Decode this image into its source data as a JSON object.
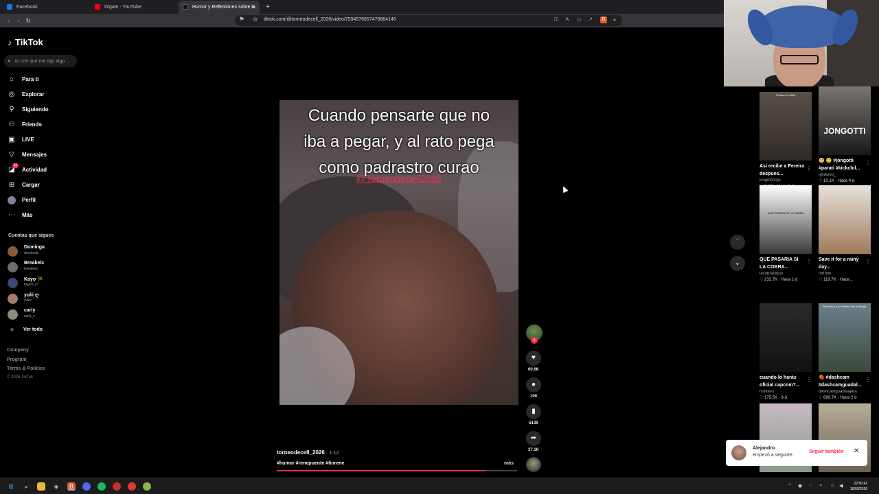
{
  "browser": {
    "tabs": [
      {
        "label": "Facebook",
        "color": "#1877f2"
      },
      {
        "label": "Dígale - YouTube",
        "color": "#ff0000"
      },
      {
        "label": "Humor y Reflexiones sobre la",
        "color": "#111111"
      }
    ],
    "url": "tiktok.com/@torneodecell_2026/video/7594576657478864146"
  },
  "sidebar": {
    "logo": "TikTok",
    "search_placeholder": "tu crei que me dijo algo ...",
    "nav": [
      {
        "label": "Para ti",
        "icon": "home-icon"
      },
      {
        "label": "Explorar",
        "icon": "compass-icon"
      },
      {
        "label": "Siguiendo",
        "icon": "user-follow-icon"
      },
      {
        "label": "Friends",
        "icon": "friends-icon"
      },
      {
        "label": "LIVE",
        "icon": "live-icon"
      },
      {
        "label": "Mensajes",
        "icon": "paper-plane-icon"
      },
      {
        "label": "Actividad",
        "icon": "bell-icon",
        "badge": "11"
      },
      {
        "label": "Cargar",
        "icon": "plus-square-icon"
      },
      {
        "label": "Perfil",
        "icon": "profile-avatar-icon"
      },
      {
        "label": "Más",
        "icon": "more-icon"
      }
    ],
    "following_title": "Cuentas que sigues",
    "following": [
      {
        "name": "Dominga",
        "handle": "domincat",
        "color": "#8a5a3c"
      },
      {
        "name": "Breakelx",
        "handle": "ibreakelx",
        "color": "#6d6d6d"
      },
      {
        "name": "Kayo 🎋",
        "handle": "kayoo_cl",
        "color": "#3a4a7a"
      },
      {
        "name": "yulii ღ",
        "handle": "yvlliv",
        "color": "#a47c6c"
      },
      {
        "name": "carly",
        "handle": "carly_v",
        "color": "#8c8c7c"
      }
    ],
    "ver_todo": "Ver todo",
    "footer_links": [
      "Company",
      "Program",
      "Terms & Policies"
    ],
    "copyright": "© 2026 TikTok"
  },
  "video": {
    "caption_lines": [
      "Cuando pensarte que no",
      "iba a pegar, y al rato pega",
      "como padrastro curao"
    ],
    "overlay_tag": "@Torneodecell2026",
    "username": "torneodecell_2026",
    "date": "1-12",
    "hashtags": "#humor #renepuente #tiorene",
    "more_label": "más",
    "progress": 0.87
  },
  "actions": {
    "follow_plus": "+",
    "likes": "60.6K",
    "comments": "109",
    "saves": "5139",
    "shares": "37.1K"
  },
  "recommendations": [
    {
      "title": "Asi recibe a Pereira despues...",
      "author": "kingofsclips",
      "stats": "♡ 5469 · Hace 5 d",
      "thumb_label": "Pereira en Chile",
      "c1": "#5a5048",
      "c2": "#2f2a26"
    },
    {
      "title": "🙂 🙂 #jongotti #parati #kickchil...",
      "author": "igxacioo_",
      "stats": "♡ 10.1K · Hace 4 d",
      "thumb_label": "JONGOTTI",
      "c1": "#7b7570",
      "c2": "#1a1a1a"
    },
    {
      "title": "QUE PASARIA SI LA COBRA...",
      "author": "lacobraclipsx",
      "stats": "♡ 232.7K · Hace 1 d",
      "thumb_label": "QUE PASARIA SI LA COBRA",
      "c1": "#ffffff",
      "c2": "#3a3a3a"
    },
    {
      "title": "Save it for a rainy day...",
      "author": "fortnite",
      "stats": "♡ 118.7K · Hace...",
      "thumb_label": "",
      "c1": "#e8e2dc",
      "c2": "#a07a5a"
    },
    {
      "title": "cuando lo harás oficial capcom?...",
      "author": "huntevs",
      "stats": "♡ 175.5K · 3-3",
      "thumb_label": "",
      "c1": "#2b2b2b",
      "c2": "#111111"
    },
    {
      "title": "🍓 #dashcam #dashcamguadal...",
      "author": "dashcamguadalajara",
      "stats": "♡ 690.7K · Hace 2 d",
      "thumb_label": "Me choca y se intenta dar a la fuga",
      "c1": "#6d7f8c",
      "c2": "#3a4a3a"
    },
    {
      "title": "",
      "author": "",
      "stats": "",
      "thumb_label": "",
      "c1": "#c9b8c4",
      "c2": "#8a9a8a"
    },
    {
      "title": "",
      "author": "",
      "stats": "",
      "thumb_label": "",
      "c1": "#b8ad98",
      "c2": "#6a6050"
    }
  ],
  "toast": {
    "name": "Alejandro",
    "message": "empezó a seguirte.",
    "follow_back": "Seguir también",
    "close": "✕"
  },
  "taskbar": {
    "time": "22:50:42",
    "date": "16/03/2026"
  },
  "colors": {
    "accent": "#fe2c55",
    "background": "#000000"
  }
}
